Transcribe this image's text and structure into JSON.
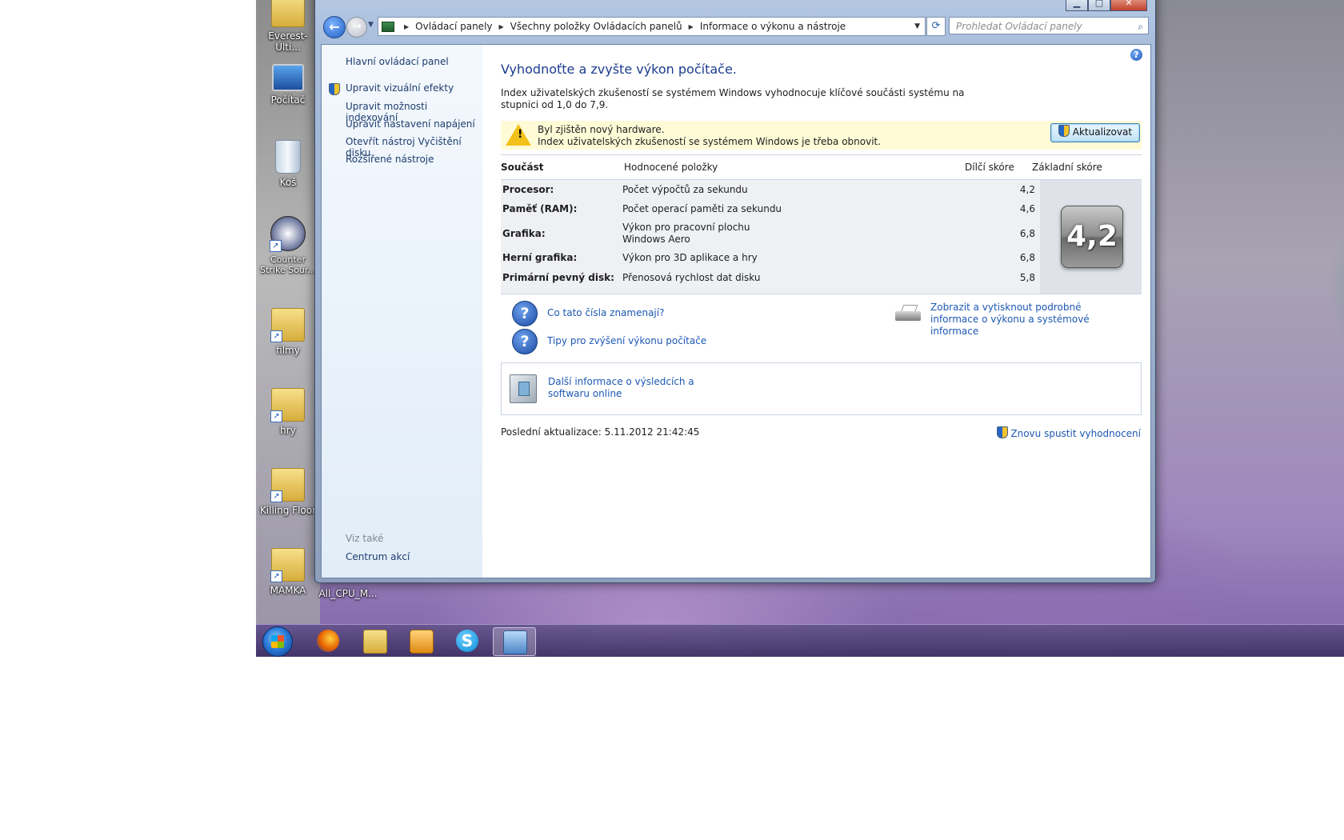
{
  "desktop": {
    "icons": [
      {
        "label": "Everest-Ulti...",
        "kind": "folder",
        "shortcut": false
      },
      {
        "label": "Počítač",
        "kind": "computer",
        "shortcut": false
      },
      {
        "label": "Koš",
        "kind": "recycle-bin",
        "shortcut": false
      },
      {
        "label": "Counter Strike Sour...",
        "kind": "game",
        "shortcut": true
      },
      {
        "label": "filmy",
        "kind": "folder",
        "shortcut": true
      },
      {
        "label": "hry",
        "kind": "folder",
        "shortcut": true
      },
      {
        "label": "Killing Floor",
        "kind": "folder",
        "shortcut": true
      },
      {
        "label": "MAMKA",
        "kind": "folder",
        "shortcut": true
      },
      {
        "label": "All_CPU_M...",
        "kind": "file",
        "shortcut": false
      }
    ]
  },
  "window": {
    "caption_buttons": {
      "minimize": "▁",
      "maximize": "□",
      "close": "✕"
    },
    "breadcrumb": [
      "Ovládací panely",
      "Všechny položky Ovládacích panelů",
      "Informace o výkonu a nástroje"
    ],
    "search_placeholder": "Prohledat Ovládací panely"
  },
  "sidebar": {
    "home": "Hlavní ovládací panel",
    "links": [
      {
        "label": "Upravit vizuální efekty",
        "shield": true
      },
      {
        "label": "Upravit možnosti indexování",
        "shield": false
      },
      {
        "label": "Upravit nastavení napájení",
        "shield": false
      },
      {
        "label": "Otevřít nástroj Vyčištění disku",
        "shield": false
      },
      {
        "label": "Rozšířené nástroje",
        "shield": false
      }
    ],
    "see_also_title": "Viz také",
    "see_also_link": "Centrum akcí"
  },
  "main": {
    "title": "Vyhodnoťte a zvyšte výkon počítače.",
    "intro": "Index uživatelských zkušeností se systémem Windows vyhodnocuje klíčové součásti systému na stupnici od 1,0 do 7,9.",
    "warning": {
      "line1": "Byl zjištěn nový hardware.",
      "line2": "Index uživatelských zkušeností se systémem Windows je třeba obnovit.",
      "button": "Aktualizovat"
    },
    "table": {
      "headers": {
        "component": "Součást",
        "rated": "Hodnocené položky",
        "subscore": "Dílčí skóre",
        "base": "Základní skóre"
      },
      "rows": [
        {
          "component": "Procesor:",
          "desc": "Počet výpočtů za sekundu",
          "score": "4,2"
        },
        {
          "component": "Paměť (RAM):",
          "desc": "Počet operací paměti za sekundu",
          "score": "4,6"
        },
        {
          "component": "Grafika:",
          "desc": "Výkon pro pracovní plochu Windows Aero",
          "score": "6,8"
        },
        {
          "component": "Herní grafika:",
          "desc": "Výkon pro 3D aplikace a hry",
          "score": "6,8"
        },
        {
          "component": "Primární pevný disk:",
          "desc": "Přenosová rychlost dat disku",
          "score": "5,8"
        }
      ],
      "base_score": "4,2"
    },
    "links": {
      "what_mean": "Co tato čísla znamenají?",
      "tips": "Tipy pro zvýšení výkonu počítače",
      "print": "Zobrazit a vytisknout podrobné informace o výkonu a systémové informace",
      "more_info": "Další informace o výsledcích a softwaru online"
    },
    "last_update": "Poslední aktualizace: 5.11.2012 21:42:45",
    "rerun": "Znovu spustit vyhodnocení"
  },
  "taskbar": {
    "items": [
      "start-button",
      "firefox",
      "explorer",
      "media-player",
      "skype",
      "control-panel"
    ],
    "active": "control-panel"
  }
}
